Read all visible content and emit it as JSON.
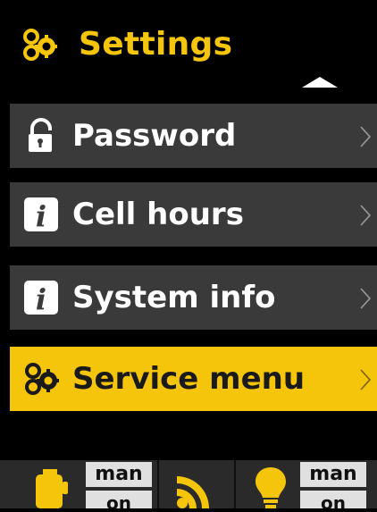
{
  "header": {
    "title": "Settings",
    "icon": "gears-icon"
  },
  "menu": {
    "items": [
      {
        "label": "Password",
        "icon": "lock-icon",
        "selected": false
      },
      {
        "label": "Cell hours",
        "icon": "info-icon",
        "selected": false
      },
      {
        "label": "System info",
        "icon": "info-icon",
        "selected": false
      },
      {
        "label": "Service menu",
        "icon": "gears-icon",
        "selected": true
      }
    ]
  },
  "footer": {
    "left_mode": "man",
    "left_state": "on",
    "right_mode": "man",
    "right_state": "on"
  },
  "colors": {
    "accent": "#f5c50b",
    "item_bg": "#3a3a3a",
    "background": "#000000",
    "footer_bg": "#2a2a2a"
  }
}
